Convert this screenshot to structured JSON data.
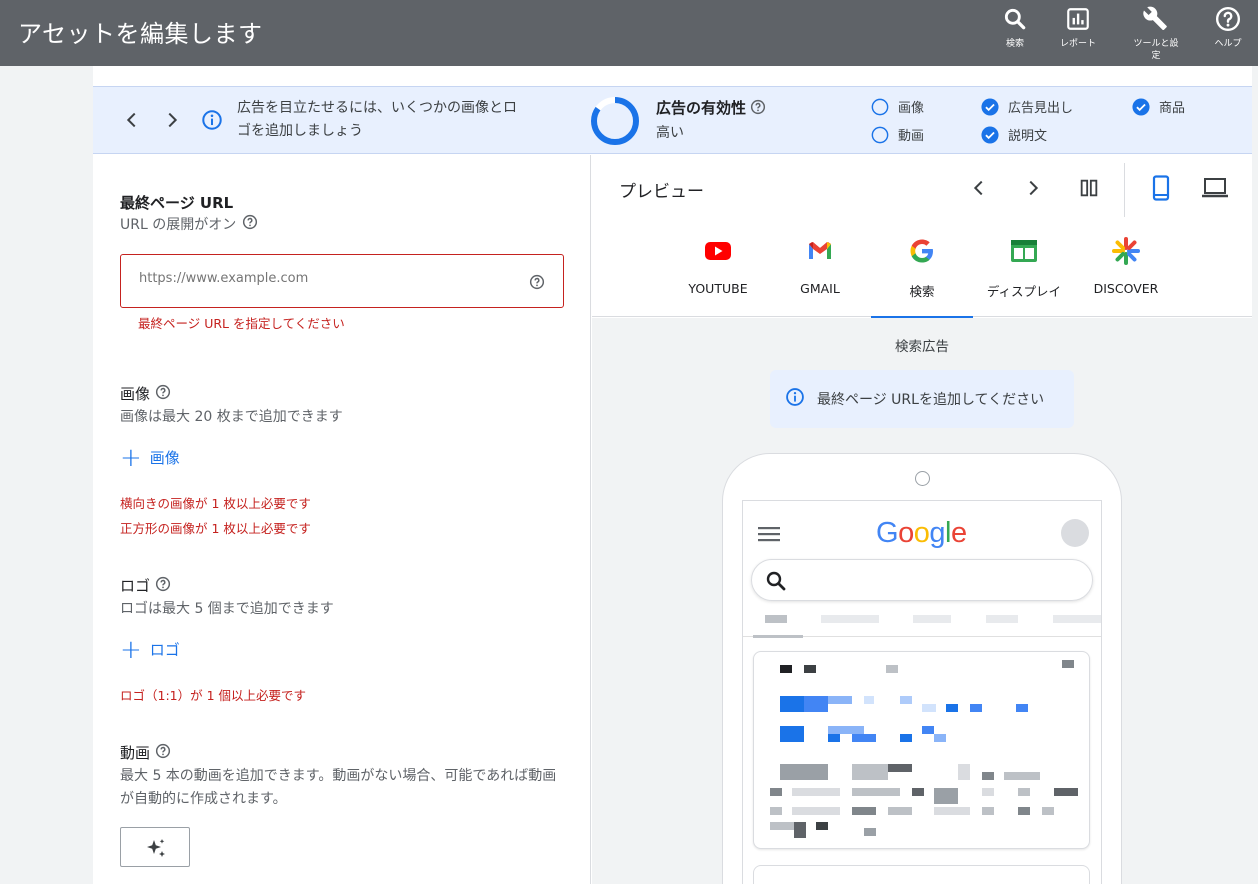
{
  "header": {
    "title": "アセットを編集します",
    "tools": [
      {
        "label": "検索",
        "icon": "search-icon"
      },
      {
        "label": "レポート",
        "icon": "report-icon"
      },
      {
        "label": "ツールと設定",
        "icon": "wrench-icon"
      },
      {
        "label": "ヘルプ",
        "icon": "help-icon"
      }
    ]
  },
  "banner": {
    "message": "広告を目立たせるには、いくつかの画像とロゴを追加しましょう",
    "effectiveness_title": "広告の有効性",
    "effectiveness_value": "高い",
    "checklist": [
      {
        "label": "画像",
        "checked": false
      },
      {
        "label": "広告見出し",
        "checked": true
      },
      {
        "label": "商品",
        "checked": true
      },
      {
        "label": "動画",
        "checked": false
      },
      {
        "label": "説明文",
        "checked": true
      }
    ]
  },
  "form": {
    "final_url": {
      "title": "最終ページ URL",
      "subtitle": "URL の展開がオン",
      "placeholder": "https://www.example.com",
      "error": "最終ページ URL を指定してください"
    },
    "images": {
      "title": "画像",
      "subtitle": "画像は最大 20 枚まで追加できます",
      "add_label": "画像",
      "errors": [
        "横向きの画像が 1 枚以上必要です",
        "正方形の画像が 1 枚以上必要です"
      ]
    },
    "logos": {
      "title": "ロゴ",
      "subtitle": "ロゴは最大 5 個まで追加できます",
      "add_label": "ロゴ",
      "error": "ロゴ（1:1）が 1 個以上必要です"
    },
    "videos": {
      "title": "動画",
      "description": "最大 5 本の動画を追加できます。動画がない場合、可能であれば動画が自動的に作成されます。"
    }
  },
  "preview": {
    "title": "プレビュー",
    "tabs": [
      {
        "label": "YOUTUBE",
        "icon": "youtube-icon"
      },
      {
        "label": "GMAIL",
        "icon": "gmail-icon"
      },
      {
        "label": "検索",
        "icon": "google-icon"
      },
      {
        "label": "ディスプレイ",
        "icon": "display-icon"
      },
      {
        "label": "DISCOVER",
        "icon": "discover-icon"
      }
    ],
    "active_tab": "検索",
    "ad_type_label": "検索広告",
    "notice": "最終ページ URLを追加してください",
    "phone": {
      "logo": "Google"
    }
  },
  "colors": {
    "header_bg": "#5f6368",
    "accent": "#1a73e8",
    "error": "#c5221f",
    "banner_bg": "#e8f0fe"
  }
}
